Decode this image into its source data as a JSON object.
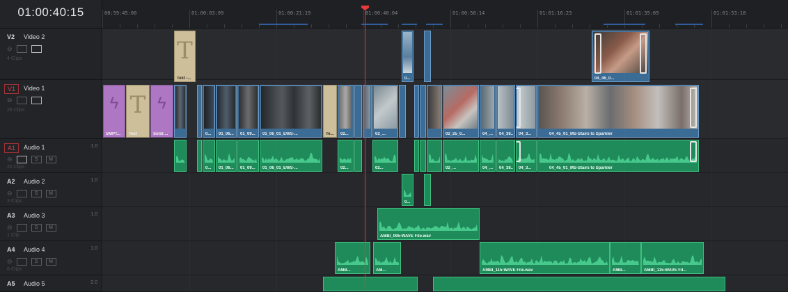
{
  "timecode": "01:00:40:15",
  "ruler": {
    "labels": [
      "00:59:45:00",
      "01:00:03:09",
      "01:00:21:19",
      "01:00:40:04",
      "01:00:58:14",
      "01:01:16:23",
      "01:01:35:09",
      "01:01:53:18"
    ]
  },
  "tracks": [
    {
      "id": "V2",
      "name": "Video 2",
      "level": "",
      "clips": "4 Clips",
      "type": "video"
    },
    {
      "id": "V1",
      "name": "Video 1",
      "level": "",
      "clips": "25 Clips",
      "type": "video"
    },
    {
      "id": "A1",
      "name": "Audio 1",
      "level": "1.0",
      "clips": "20 Clips",
      "type": "audio"
    },
    {
      "id": "A2",
      "name": "Audio 2",
      "level": "1.0",
      "clips": "3 Clips",
      "type": "audio"
    },
    {
      "id": "A3",
      "name": "Audio 3",
      "level": "1.0",
      "clips": "1 Clip",
      "type": "audio"
    },
    {
      "id": "A4",
      "name": "Audio 4",
      "level": "1.0",
      "clips": "6 Clips",
      "type": "audio"
    },
    {
      "id": "A5",
      "name": "Audio 5",
      "level": "2.0",
      "clips": "",
      "type": "audio"
    }
  ],
  "track_controls": {
    "solo": "S",
    "mute": "M"
  },
  "clip_labels": {
    "v2_text": "Text -...",
    "v2_clip_small": "0...",
    "v2_clip_right": "04_46_0...",
    "v1_smpte": "SMPT...",
    "v1_text": "Text",
    "v1_solid": "Solid ...",
    "v1_c1": "0...",
    "v1_c2": "01_06...",
    "v1_c3": "01_09...",
    "v1_c4": "01_06_01_EWS-...",
    "v1_c5": "Te...",
    "v1_c6": "02...",
    "v1_c7": "02_...",
    "v1_c8": "02_25_0...",
    "v1_c9": "04_...",
    "v1_c10": "04_38...",
    "v1_c11": "04_3...",
    "v1_c12": "04_45_01_MS-Stairs to Sparkler",
    "a1_c1": "0...",
    "a1_c2": "01_06...",
    "a1_c3": "01_09...",
    "a1_c4": "01_06_01_EWS-...",
    "a1_c5": "02...",
    "a1_c6": "02...",
    "a1_c7": "02_...",
    "a1_c8": "04_...",
    "a1_c9": "04_38...",
    "a1_c10": "04_3...",
    "a1_c11": "04_45_01_MS-Stairs to Sparkler",
    "a2_c1": "0...",
    "a3_c1": "AMBI_095-WAVE File.wav",
    "a4_c1": "AMB...",
    "a4_c2": "AM...",
    "a4_c3": "AMBI_115-WAVE File.wav",
    "a4_c4": "AMB...",
    "a4_c5": "AMBI_115-WAVE Fil..."
  },
  "colors": {
    "playhead": "#e63b3b",
    "video_clip": "#3b6c96",
    "audio_clip": "#1f8a5a",
    "title_clip": "#cdbf9a",
    "generator_clip": "#ae77c3"
  },
  "icons": [
    "lock-icon",
    "auto-select-icon",
    "track-visibility-icon",
    "solo-icon",
    "mute-icon",
    "link-icon",
    "transform-icon",
    "keyframe-icon",
    "fade-curve-icon"
  ]
}
